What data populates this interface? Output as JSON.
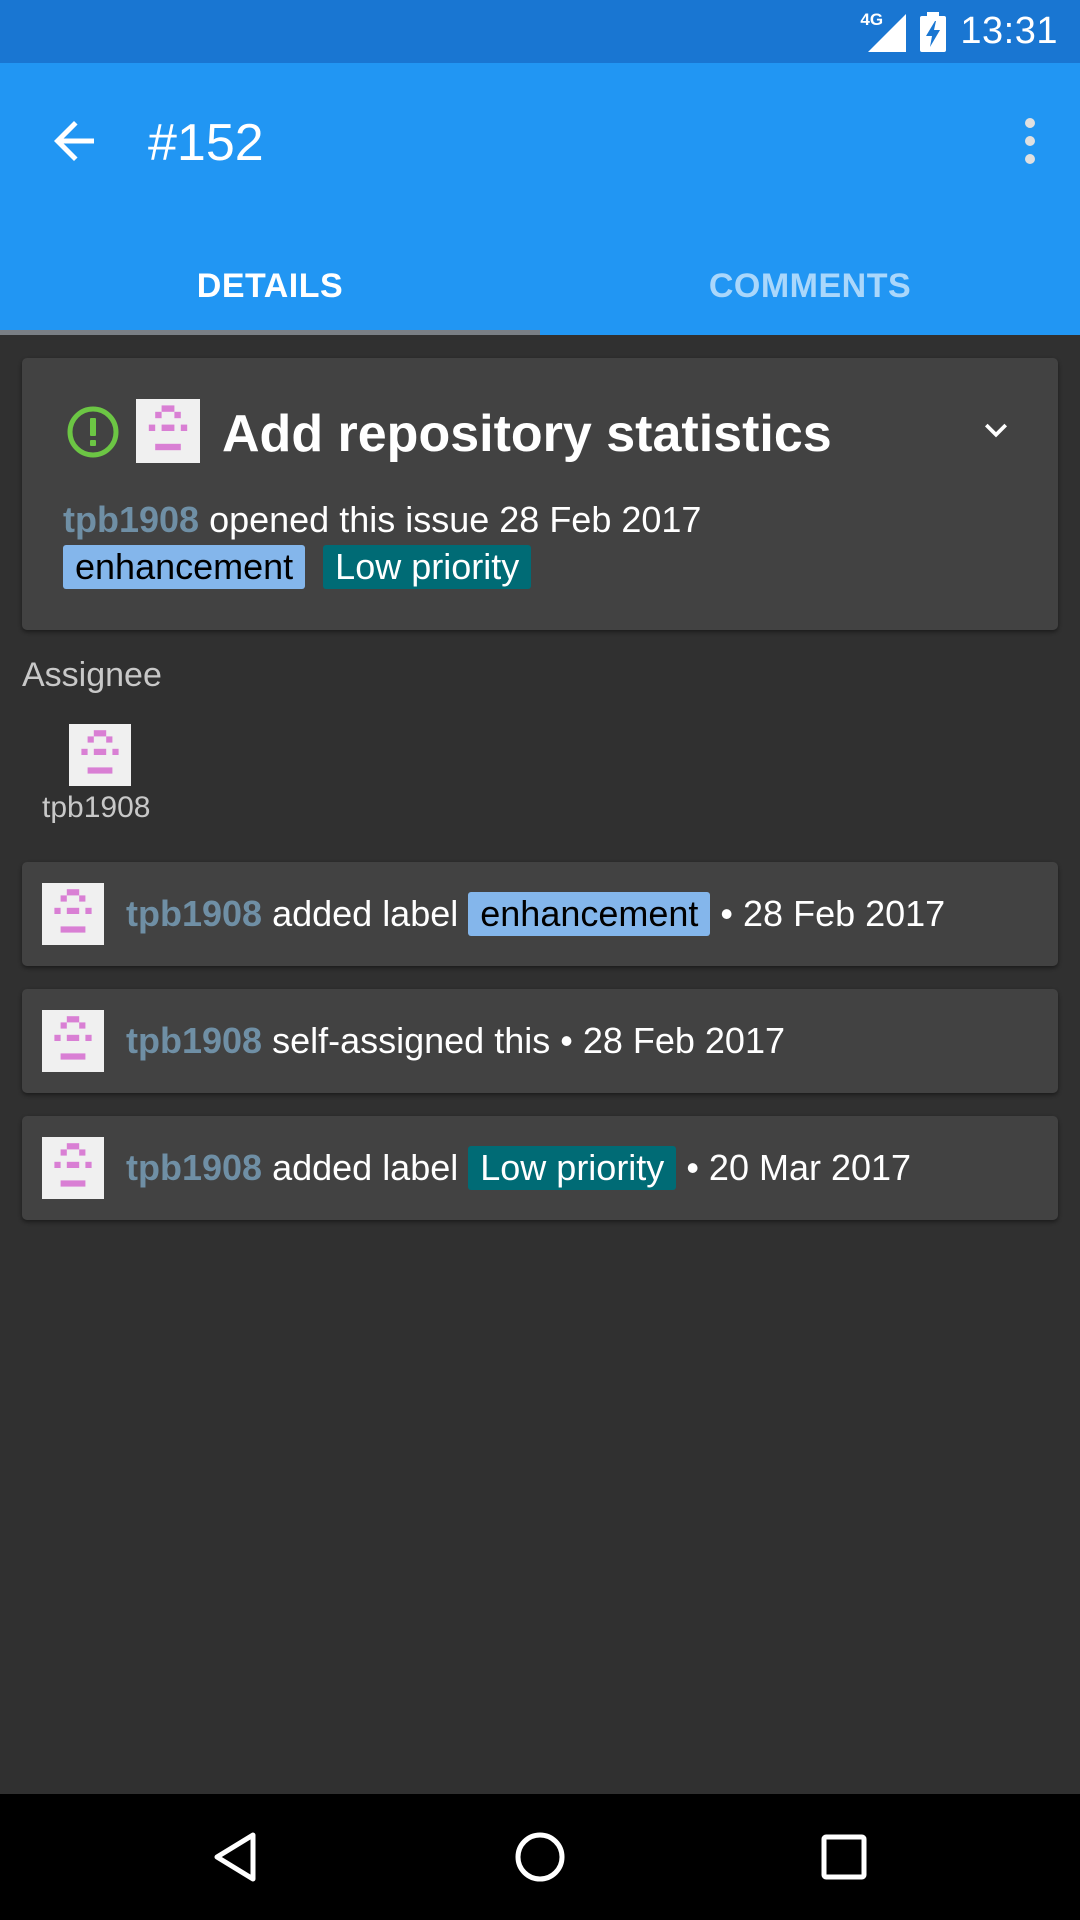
{
  "status_bar": {
    "time": "13:31",
    "network": "4G"
  },
  "app_bar": {
    "title": "#152"
  },
  "tabs": [
    {
      "label": "DETAILS",
      "active": true
    },
    {
      "label": "COMMENTS",
      "active": false
    }
  ],
  "issue": {
    "title": "Add repository statistics",
    "author": "tpb1908",
    "opened_text": "opened this issue 28 Feb 2017",
    "labels": [
      {
        "name": "enhancement",
        "color": "#84b6eb"
      },
      {
        "name": "Low priority",
        "color": "#006b75"
      }
    ]
  },
  "assignee": {
    "heading": "Assignee",
    "name": "tpb1908"
  },
  "events": [
    {
      "user": "tpb1908",
      "action": "added label",
      "label": "enhancement",
      "date": "• 28 Feb 2017"
    },
    {
      "user": "tpb1908",
      "action": "self-assigned this • 28 Feb 2017"
    },
    {
      "user": "tpb1908",
      "action": "added label",
      "label": "Low priority",
      "date": "• 20 Mar 2017"
    }
  ],
  "colors": {
    "status_bar": "#1976d2",
    "app_bar": "#2196f3",
    "background": "#303030",
    "card": "#424242",
    "user_link": "#6f8fa5",
    "open_icon": "#6cc644"
  },
  "icons": {
    "back": "arrow-back-icon",
    "menu": "more-vert-icon",
    "open_status": "issue-opened-icon",
    "expand": "chevron-down-icon",
    "nav_back": "nav-back-icon",
    "nav_home": "nav-home-icon",
    "nav_recents": "nav-recents-icon"
  }
}
